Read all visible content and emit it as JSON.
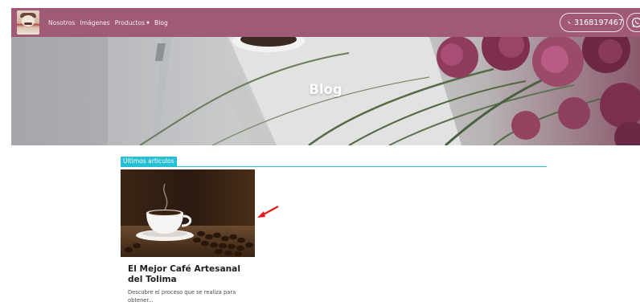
{
  "nav": {
    "items": [
      {
        "label": "Nosotros"
      },
      {
        "label": "Imágenes"
      },
      {
        "label": "Productos",
        "has_dropdown": true
      },
      {
        "label": "Blog"
      }
    ],
    "phone": "3168197467",
    "icons": {
      "logo": "logo-portrait",
      "phone": "phone-icon",
      "whatsapp": "whatsapp-icon",
      "dropdown": "caret-down-icon"
    },
    "colors": {
      "bar": "#a05a78",
      "accent": "#25c0d3"
    }
  },
  "hero": {
    "title": "Blog"
  },
  "section": {
    "badge": "Últimos artículos"
  },
  "post": {
    "title": "El Mejor Café Artesanal del Tolima",
    "excerpt": "Descubre el proceso que se realiza para obtener..."
  }
}
